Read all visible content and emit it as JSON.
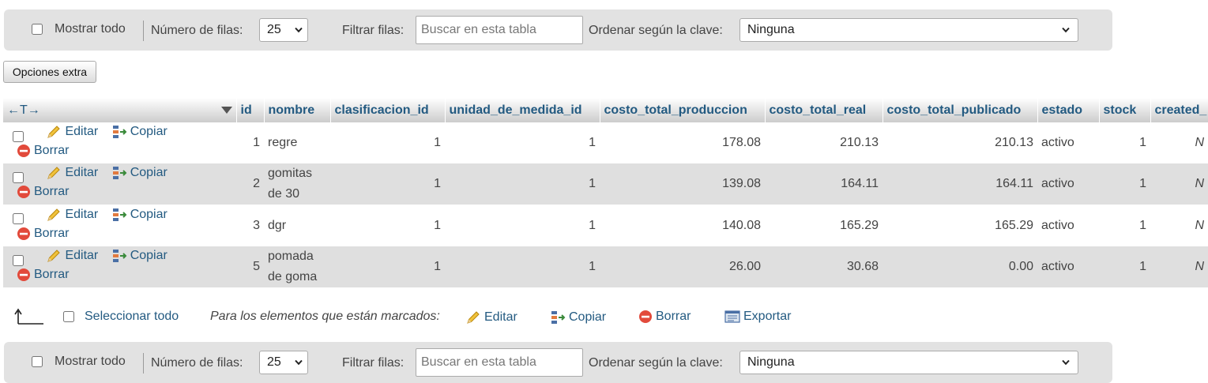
{
  "navigation": {
    "show_all_label": "Mostrar todo",
    "rows_label": "Número de filas:",
    "rows_value": "25",
    "filter_label": "Filtrar filas:",
    "filter_placeholder": "Buscar en esta tabla",
    "sort_label": "Ordenar según la clave:",
    "sort_value": "Ninguna"
  },
  "extra_options_label": "Opciones extra",
  "table": {
    "sort_arrows": "←T→",
    "columns": [
      "id",
      "nombre",
      "clasificacion_id",
      "unidad_de_medida_id",
      "costo_total_produccion",
      "costo_total_real",
      "costo_total_publicado",
      "estado",
      "stock",
      "created_"
    ],
    "action_labels": {
      "edit": "Editar",
      "copy": "Copiar",
      "delete": "Borrar"
    },
    "rows": [
      {
        "id": "1",
        "nombre": "regre",
        "clasificacion_id": "1",
        "unidad_de_medida_id": "1",
        "costo_total_produccion": "178.08",
        "costo_total_real": "210.13",
        "costo_total_publicado": "210.13",
        "estado": "activo",
        "stock": "1",
        "created": "N"
      },
      {
        "id": "2",
        "nombre": "gomitas de 30",
        "clasificacion_id": "1",
        "unidad_de_medida_id": "1",
        "costo_total_produccion": "139.08",
        "costo_total_real": "164.11",
        "costo_total_publicado": "164.11",
        "estado": "activo",
        "stock": "1",
        "created": "N"
      },
      {
        "id": "3",
        "nombre": "dgr",
        "clasificacion_id": "1",
        "unidad_de_medida_id": "1",
        "costo_total_produccion": "140.08",
        "costo_total_real": "165.29",
        "costo_total_publicado": "165.29",
        "estado": "activo",
        "stock": "1",
        "created": "N"
      },
      {
        "id": "5",
        "nombre": "pomada de goma",
        "clasificacion_id": "1",
        "unidad_de_medida_id": "1",
        "costo_total_produccion": "26.00",
        "costo_total_real": "30.68",
        "costo_total_publicado": "0.00",
        "estado": "activo",
        "stock": "1",
        "created": "N"
      }
    ]
  },
  "bulk_actions": {
    "select_all_label": "Seleccionar todo",
    "marked_label": "Para los elementos que están marcados:",
    "edit": "Editar",
    "copy": "Copiar",
    "delete": "Borrar",
    "export": "Exportar"
  },
  "icons": [
    "pencil-icon",
    "copy-icon",
    "delete-icon",
    "export-icon",
    "arrow-up-left-icon",
    "chevron-down-icon",
    "sort-arrow-icon"
  ],
  "colors": {
    "link": "#235a81",
    "toolbar_bg": "#e2e2e2",
    "even_row": "#dfdfdf",
    "delete_red": "#e24a3b",
    "pencil_yellow": "#f0c23b"
  }
}
